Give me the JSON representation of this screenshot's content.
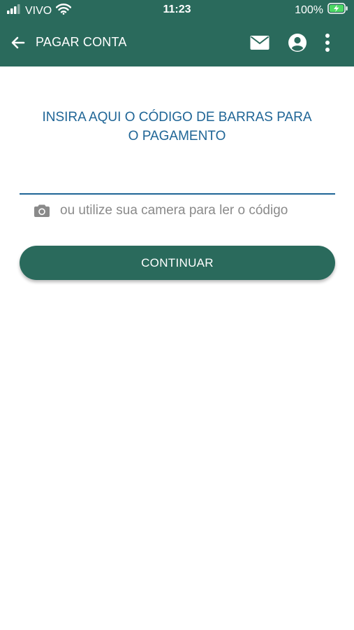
{
  "status_bar": {
    "carrier": "VIVO",
    "time": "11:23",
    "battery": "100%",
    "icons": [
      "signal-icon",
      "wifi-icon",
      "battery-charging-icon"
    ]
  },
  "toolbar": {
    "title": "PAGAR CONTA",
    "back_icon": "arrow-left-icon",
    "actions": [
      "mail-icon",
      "account-icon",
      "more-vertical-icon"
    ]
  },
  "main": {
    "heading_line1": "INSIRA AQUI O CÓDIGO DE BARRAS PARA",
    "heading_line2": "O PAGAMENTO",
    "barcode_value": "",
    "barcode_placeholder": "",
    "camera_text": "ou utilize sua camera para ler o código",
    "camera_icon": "camera-icon",
    "continue_label": "CONTINUAR"
  },
  "colors": {
    "primary": "#2a6a5c",
    "heading": "#1f6596",
    "muted": "#8a8a8a",
    "battery": "#4cd964"
  }
}
